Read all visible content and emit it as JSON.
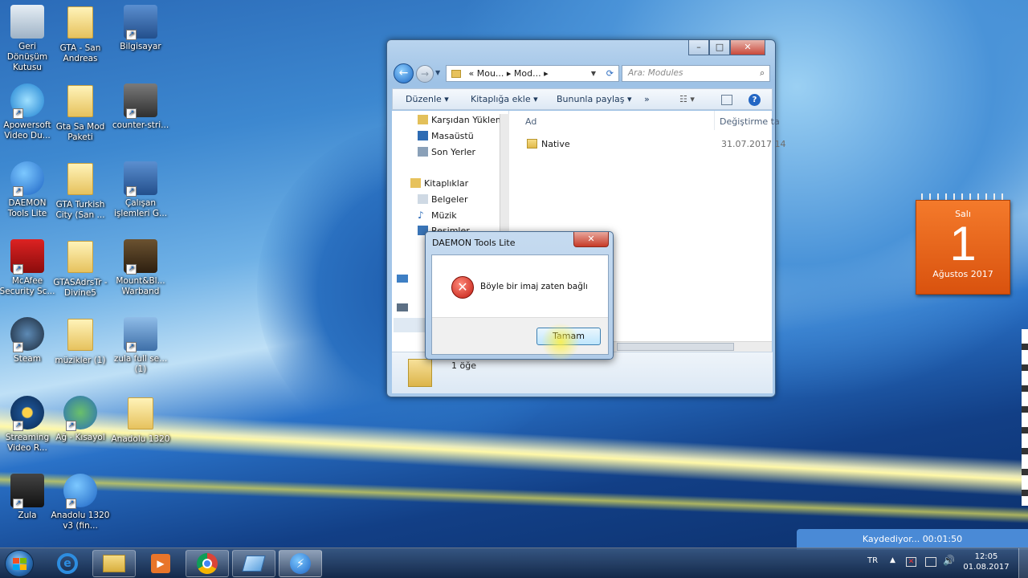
{
  "desktop": {
    "icons": [
      {
        "label": "Geri Dönüşüm Kutusu",
        "icon": "recycle-bin-icon"
      },
      {
        "label": "GTA - San Andreas",
        "icon": "folder-icon"
      },
      {
        "label": "Bilgisayar",
        "icon": "computer-icon"
      },
      {
        "label": "Apowersoft Video Du...",
        "icon": "apowersoft-icon"
      },
      {
        "label": "Gta Sa Mod Paketi",
        "icon": "folder-icon"
      },
      {
        "label": "counter-stri...",
        "icon": "counter-strike-icon"
      },
      {
        "label": "DAEMON Tools Lite",
        "icon": "daemon-tools-icon"
      },
      {
        "label": "GTA Turkish City (San ...",
        "icon": "folder-icon"
      },
      {
        "label": "Çalışan işlemleri G...",
        "icon": "task-manager-icon"
      },
      {
        "label": "McAfee Security Sc...",
        "icon": "mcafee-icon"
      },
      {
        "label": "GTASAdrsTr - Divine5",
        "icon": "folder-icon"
      },
      {
        "label": "Mount&Bl... Warband",
        "icon": "warband-icon"
      },
      {
        "label": "Steam",
        "icon": "steam-icon"
      },
      {
        "label": "müzikler (1)",
        "icon": "folder-icon"
      },
      {
        "label": "zula full se... (1)",
        "icon": "installer-icon"
      },
      {
        "label": "Streaming Video R...",
        "icon": "streaming-icon"
      },
      {
        "label": "Ağ - Kısayol",
        "icon": "network-icon"
      },
      {
        "label": "Anadolu 1320",
        "icon": "folder-icon"
      },
      {
        "label": "Zula",
        "icon": "zula-icon"
      },
      {
        "label": "Anadolu 1320 v3 (fin...",
        "icon": "daemon-tools-icon"
      }
    ]
  },
  "explorer": {
    "address": "« Mou... ▸ Mod... ▸",
    "search_placeholder": "Ara: Modules",
    "toolbar": {
      "organize": "Düzenle",
      "library": "Kitaplığa ekle",
      "share": "Bununla paylaş",
      "more": "»"
    },
    "nav": {
      "downloads": "Karşıdan Yüklem",
      "desktop": "Masaüstü",
      "recent": "Son Yerler",
      "libraries": "Kitaplıklar",
      "documents": "Belgeler",
      "music": "Müzik",
      "pictures": "Resimler"
    },
    "columns": {
      "name": "Ad",
      "modified": "Değiştirme ta"
    },
    "files": [
      {
        "name": "Native",
        "date": "31.07.2017 14"
      }
    ],
    "status": "1 öğe"
  },
  "dialog": {
    "title": "DAEMON Tools Lite",
    "message": "Böyle bir imaj zaten bağlı",
    "ok": "Tamam",
    "close": "✕"
  },
  "calendar": {
    "day_name": "Salı",
    "day": "1",
    "month_year": "Ağustos 2017"
  },
  "recorder": {
    "text": "Kaydediyor... 00:01:50"
  },
  "tray": {
    "lang": "TR",
    "time": "12:05",
    "date": "01.08.2017"
  }
}
